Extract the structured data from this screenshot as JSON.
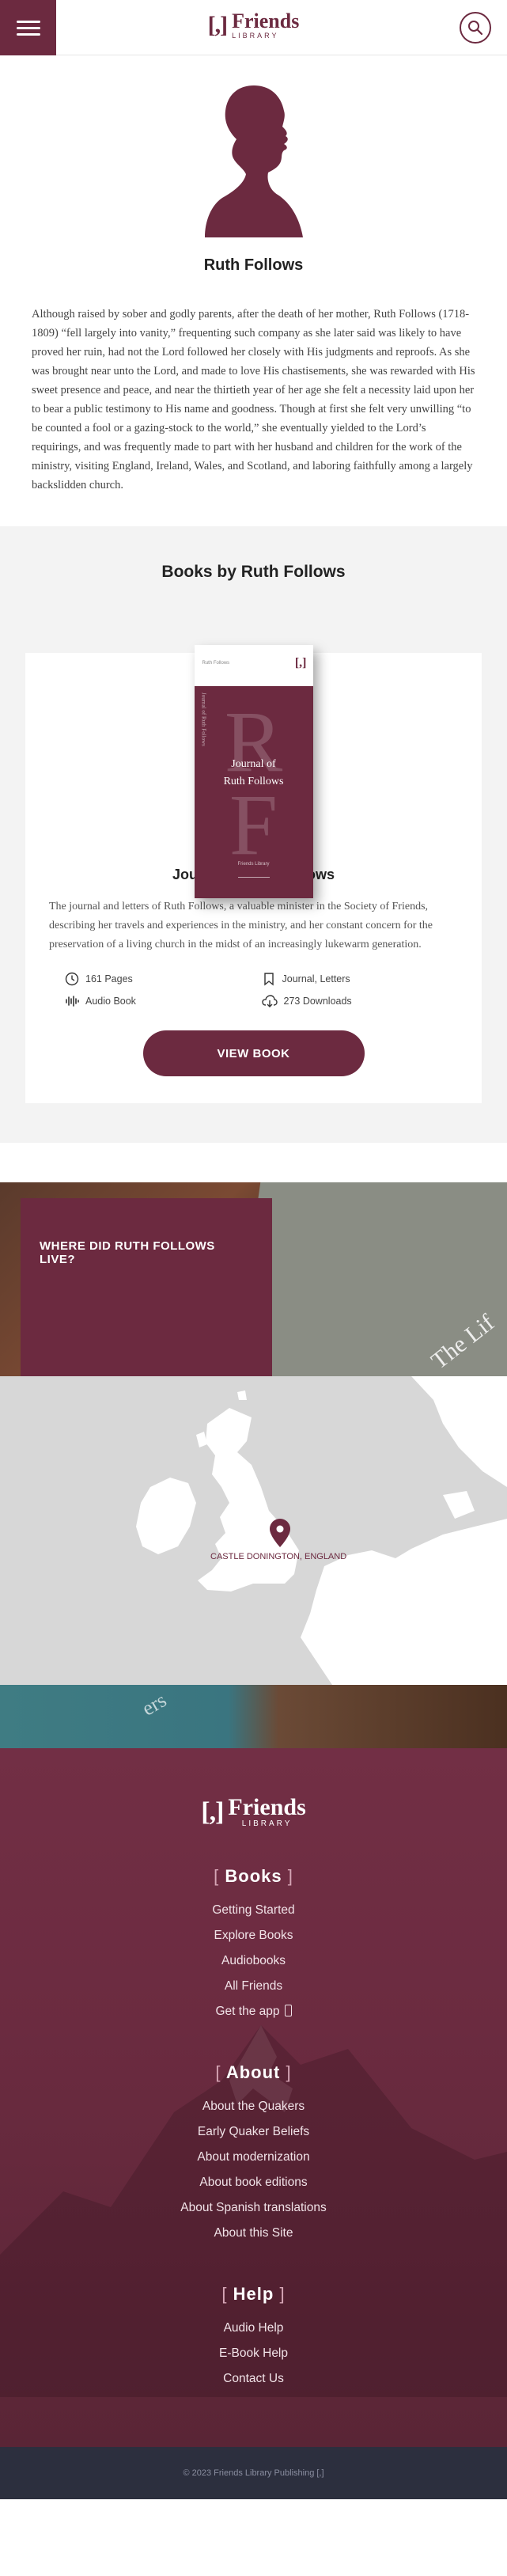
{
  "header": {
    "logo_mark": "[,]",
    "logo_title": "Friends",
    "logo_sub": "LIBRARY"
  },
  "profile": {
    "name": "Ruth Follows",
    "bio": "Although raised by sober and godly parents, after the death of her mother, Ruth Follows (1718-1809) “fell largely into vanity,” frequenting such company as she later said was likely to have proved her ruin, had not the Lord followed her closely with His judgments and reproofs. As she was brought near unto the Lord, and made to love His chastisements, she was rewarded with His sweet presence and peace, and near the thirtieth year of her age she felt a necessity laid upon her to bear a public testimony to His name and goodness. Though at first she felt very unwilling “to be counted a fool or a gazing-stock to the world,” she eventually yielded to the Lord’s requirings, and was frequently made to part with her husband and children for the work of the ministry, visiting England, Ireland, Wales, and Scotland, and laboring faithfully among a largely backslidden church."
  },
  "books": {
    "heading": "Books by Ruth Follows",
    "book": {
      "cover_author": "Ruth Follows",
      "cover_logo": "[,]",
      "cover_letters": "R F",
      "cover_title_line1": "Journal of",
      "cover_title_line2": "Ruth Follows",
      "cover_spine": "Journal of Ruth Follows",
      "cover_publisher": "Friends Library",
      "title": "Journal of Ruth Follows",
      "description": "The journal and letters of Ruth Follows, a valuable minister in the Society of Friends, describing her travels and experiences in the ministry, and her constant concern for the preservation of a living church in the midst of an increasingly lukewarm generation.",
      "pages": "161 Pages",
      "tags": "Journal, Letters",
      "audio": "Audio Book",
      "downloads": "273 Downloads",
      "button": "VIEW BOOK"
    }
  },
  "where": {
    "heading": "WHERE DID RUTH FOLLOWS LIVE?",
    "bg_text": "The Lif"
  },
  "map": {
    "location": "CASTLE DONINGTON, ENGLAND"
  },
  "footer": {
    "strip_text": "ers",
    "logo_mark": "[,]",
    "logo_title": "Friends",
    "logo_sub": "LIBRARY",
    "sections": [
      {
        "title": "Books",
        "links": [
          "Getting Started",
          "Explore Books",
          "Audiobooks",
          "All Friends",
          "Get the app"
        ]
      },
      {
        "title": "About",
        "links": [
          "About the Quakers",
          "Early Quaker Beliefs",
          "About modernization",
          "About book editions",
          "About Spanish translations",
          "About this Site"
        ]
      },
      {
        "title": "Help",
        "links": [
          "Audio Help",
          "E-Book Help",
          "Contact Us"
        ]
      }
    ],
    "copyright": "© 2023 Friends Library Publishing [,]"
  },
  "colors": {
    "brand": "#6c2a40",
    "map_land": "#ffffff",
    "map_sea": "#d7d7d7",
    "copyright_bg": "#2c2f3e"
  }
}
